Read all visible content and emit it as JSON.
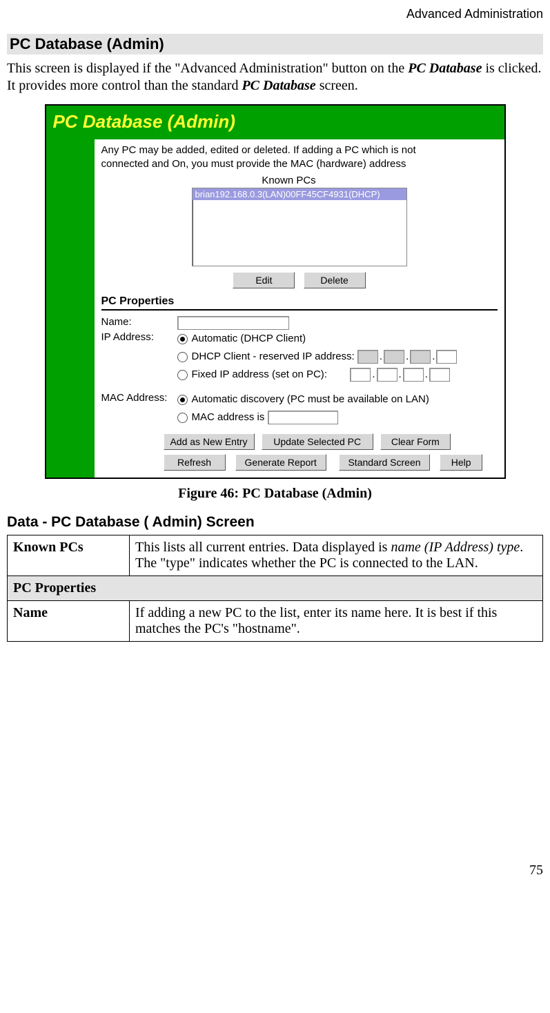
{
  "header": {
    "right": "Advanced Administration"
  },
  "title": "PC Database (Admin)",
  "intro": {
    "part1": "This screen is displayed if the \"Advanced Administration\" button on the ",
    "em1": "PC Database",
    "part2": " is clicked. It provides more control than the standard ",
    "em2": "PC Database",
    "part3": " screen."
  },
  "screenshot": {
    "title": "PC Database (Admin)",
    "note_line1": "Any PC may be added, edited or deleted. If adding a PC which is not",
    "note_line2": "connected and On, you must provide the MAC (hardware) address",
    "known_label": "Known PCs",
    "list_entry": "brian192.168.0.3(LAN)00FF45CF4931(DHCP)",
    "btn_edit": "Edit",
    "btn_delete": "Delete",
    "pcprops_header": "PC Properties",
    "lbl_name": "Name:",
    "lbl_ip": "IP Address:",
    "radio_auto": "Automatic (DHCP Client)",
    "radio_reserved": "DHCP Client - reserved IP address:",
    "radio_fixed": "Fixed IP address (set on PC):",
    "lbl_mac": "MAC Address:",
    "radio_mac_auto": "Automatic discovery (PC must be available on LAN)",
    "radio_mac_is": "MAC address is",
    "btn_add": "Add as New Entry",
    "btn_update": "Update Selected PC",
    "btn_clear": "Clear Form",
    "btn_refresh": "Refresh",
    "btn_report": "Generate Report",
    "btn_standard": "Standard Screen",
    "btn_help": "Help"
  },
  "figcaption": "Figure 46: PC Database (Admin)",
  "subsection": "Data - PC Database ( Admin) Screen",
  "table": {
    "row1_term": "Known PCs",
    "row1_desc_a": "This lists all current entries. Data displayed is ",
    "row1_desc_i": "name (IP Address) type",
    "row1_desc_b": ". The \"type\" indicates whether the PC is connected to the LAN.",
    "row2_header": "PC Properties",
    "row3_term": "Name",
    "row3_desc": "If adding a new PC to the list, enter its name here. It is best if this matches the PC's \"hostname\"."
  },
  "pagenum": "75"
}
